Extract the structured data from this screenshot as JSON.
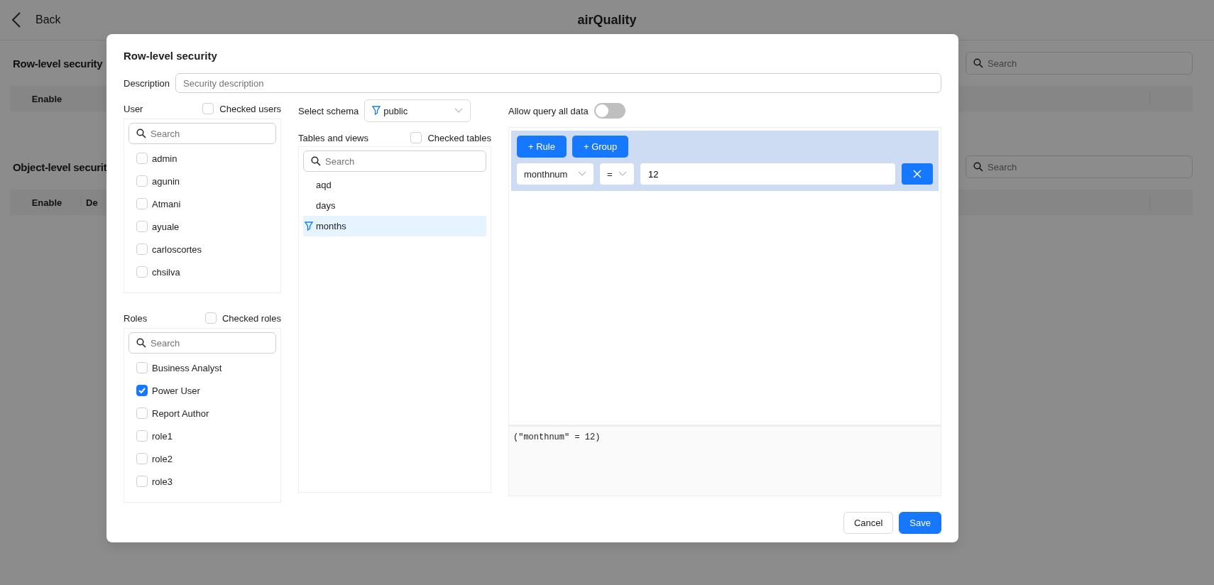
{
  "page": {
    "back": "Back",
    "title": "airQuality"
  },
  "background_sections": [
    {
      "heading": "Row-level security",
      "search_placeholder": "Search",
      "columns": [
        "Enable"
      ]
    },
    {
      "heading": "Object-level securit",
      "search_placeholder": "Search",
      "columns": [
        "Enable",
        "De"
      ]
    }
  ],
  "dialog": {
    "title": "Row-level security",
    "description": {
      "label": "Description",
      "placeholder": "Security description"
    },
    "users": {
      "label": "User",
      "checked_filter": {
        "label": "Checked users",
        "checked": false
      },
      "search_placeholder": "Search",
      "items": [
        {
          "label": "admin",
          "checked": false
        },
        {
          "label": "agunin",
          "checked": false
        },
        {
          "label": "Atmani",
          "checked": false
        },
        {
          "label": "ayuale",
          "checked": false
        },
        {
          "label": "carloscortes",
          "checked": false
        },
        {
          "label": "chsilva",
          "checked": false
        }
      ]
    },
    "roles": {
      "label": "Roles",
      "checked_filter": {
        "label": "Checked roles",
        "checked": false
      },
      "search_placeholder": "Search",
      "items": [
        {
          "label": "Business Analyst",
          "checked": false
        },
        {
          "label": "Power User",
          "checked": true
        },
        {
          "label": "Report Author",
          "checked": false
        },
        {
          "label": "role1",
          "checked": false
        },
        {
          "label": "role2",
          "checked": false
        },
        {
          "label": "role3",
          "checked": false
        }
      ]
    },
    "schema": {
      "label": "Select schema",
      "value": "public"
    },
    "tables": {
      "label": "Tables and views",
      "checked_filter": {
        "label": "Checked tables",
        "checked": false
      },
      "search_placeholder": "Search",
      "items": [
        {
          "label": "aqd",
          "selected": false,
          "filtered": false
        },
        {
          "label": "days",
          "selected": false,
          "filtered": false
        },
        {
          "label": "months",
          "selected": true,
          "filtered": true
        }
      ]
    },
    "allow_query_all": {
      "label": "Allow query all data",
      "on": false
    },
    "query_builder": {
      "buttons": [
        "+ Rule",
        "+ Group"
      ],
      "rules": [
        {
          "field": "monthnum",
          "operator": "=",
          "value": "12"
        }
      ]
    },
    "sql_preview": "(\"monthnum\" = 12)",
    "buttons": [
      {
        "label": "Cancel",
        "kind": "secondary"
      },
      {
        "label": "Save",
        "kind": "primary"
      }
    ]
  }
}
